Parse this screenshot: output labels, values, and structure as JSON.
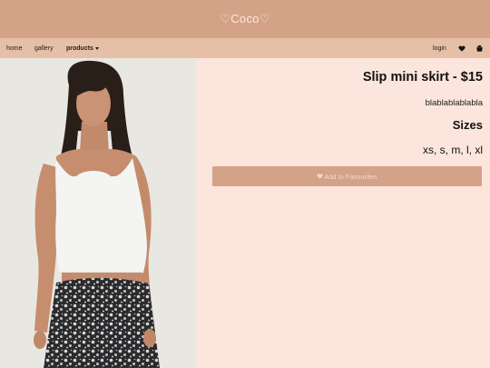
{
  "header": {
    "brand": "♡Coco♡"
  },
  "nav": {
    "home": "home",
    "gallery": "gallery",
    "products": "products",
    "login": "login",
    "heart_icon": "heart-icon",
    "cart_icon": "shopping-bag-icon"
  },
  "product": {
    "title": "Slip mini skirt - $15",
    "description": "blablablablabla",
    "sizes_heading": "Sizes",
    "sizes": "xs, s, m, l, xl",
    "favourite_button": "Add to Favourites"
  },
  "colors": {
    "header": "#d4a286",
    "navbar": "#e6bfa7",
    "background": "#fbe5dc",
    "button": "#d4a286"
  }
}
